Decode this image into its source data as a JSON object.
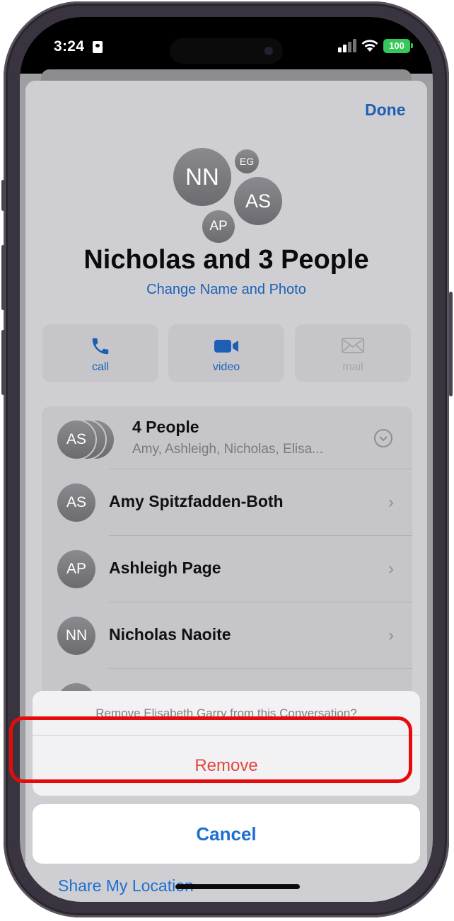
{
  "status_bar": {
    "time": "3:24",
    "battery": "100"
  },
  "header": {
    "done_label": "Done"
  },
  "group": {
    "avatars": {
      "main": "NN",
      "small_top": "EG",
      "right": "AS",
      "bottom": "AP"
    },
    "title": "Nicholas and 3 People",
    "change_label": "Change Name and Photo"
  },
  "actions": {
    "call": "call",
    "video": "video",
    "mail": "mail"
  },
  "members": {
    "group_row": {
      "initials": "AS",
      "title": "4 People",
      "subtitle": "Amy, Ashleigh, Nicholas, Elisa..."
    },
    "rows": [
      {
        "initials": "AS",
        "name": "Amy Spitzfadden-Both"
      },
      {
        "initials": "AP",
        "name": "Ashleigh Page"
      },
      {
        "initials": "NN",
        "name": "Nicholas Naoite"
      }
    ]
  },
  "action_sheet": {
    "message": "Remove Elisabeth Garry from this Conversation?",
    "remove_label": "Remove",
    "cancel_label": "Cancel"
  },
  "footer": {
    "share_location": "Share My Location"
  },
  "colors": {
    "accent": "#1d5fb5",
    "destructive": "#e2463c",
    "highlight": "#e50b0b",
    "battery": "#34c759"
  }
}
